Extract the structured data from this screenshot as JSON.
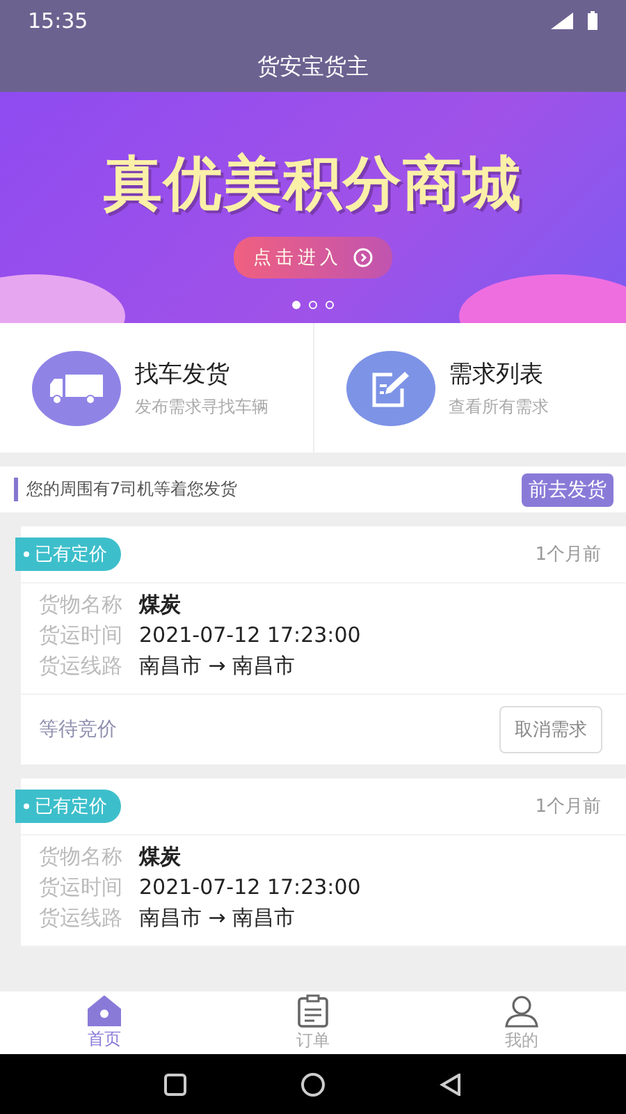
{
  "status_bar": {
    "time": "15:35"
  },
  "header": {
    "title": "货安宝货主"
  },
  "banner": {
    "headline": "真优美积分商城",
    "button": "点击进入",
    "dots": [
      {
        "selected": true
      },
      {
        "selected": false
      },
      {
        "selected": false
      }
    ]
  },
  "actions": [
    {
      "kind": "truck",
      "title": "找车发货",
      "subtitle": "发布需求寻找车辆"
    },
    {
      "kind": "edit",
      "title": "需求列表",
      "subtitle": "查看所有需求"
    }
  ],
  "notice": {
    "text": "您的周围有7司机等着您发货",
    "button": "前去发货"
  },
  "orders": [
    {
      "tag": "已有定价",
      "time_ago": "1个月前",
      "fields": [
        {
          "label": "货物名称",
          "value": "煤炭",
          "bold": true
        },
        {
          "label": "货运时间",
          "value": "2021-07-12 17:23:00",
          "bold": false
        },
        {
          "label": "货运线路",
          "value": "南昌市 → 南昌市",
          "bold": false
        }
      ],
      "status": "等待竞价",
      "action": "取消需求"
    },
    {
      "tag": "已有定价",
      "time_ago": "1个月前",
      "fields": [
        {
          "label": "货物名称",
          "value": "煤炭",
          "bold": true
        },
        {
          "label": "货运时间",
          "value": "2021-07-12 17:23:00",
          "bold": false
        },
        {
          "label": "货运线路",
          "value": "南昌市 → 南昌市",
          "bold": false
        }
      ]
    }
  ],
  "tab_bar": [
    {
      "kind": "home",
      "label": "首页",
      "selected": true
    },
    {
      "kind": "orders",
      "label": "订单",
      "selected": false
    },
    {
      "kind": "profile",
      "label": "我的",
      "selected": false
    }
  ]
}
